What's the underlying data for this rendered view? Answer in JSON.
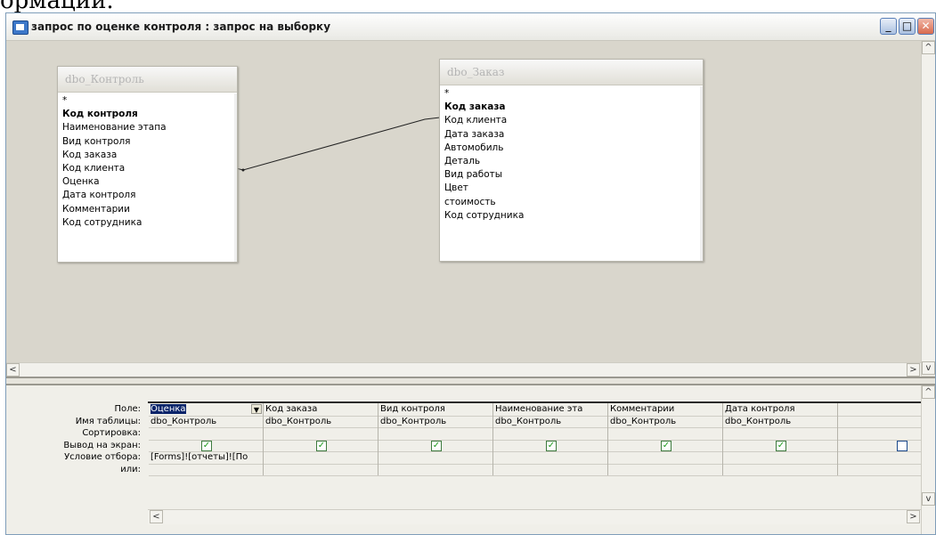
{
  "caption_above": "ормации.",
  "window": {
    "title": "запрос по оценке контроля : запрос на выборку",
    "minimize": "_",
    "maximize": "□",
    "close": "✕"
  },
  "tables": [
    {
      "name": "dbo_Контроль",
      "fields": [
        "*",
        "Код контроля",
        "Наименование этапа",
        "Вид контроля",
        "Код заказа",
        "Код клиента",
        "Оценка",
        "Дата контроля",
        "Комментарии",
        "Код сотрудника"
      ],
      "key_field": "Код контроля"
    },
    {
      "name": "dbo_Заказ",
      "fields": [
        "*",
        "Код заказа",
        "Код клиента",
        "Дата заказа",
        "Автомобиль",
        "Деталь",
        "Вид работы",
        "Цвет",
        "стоимость",
        "Код сотрудника"
      ],
      "key_field": "Код заказа"
    }
  ],
  "grid": {
    "row_labels": [
      "Поле:",
      "Имя таблицы:",
      "Сортировка:",
      "Вывод на экран:",
      "Условие отбора:",
      "или:"
    ],
    "columns": [
      {
        "field": "Оценка",
        "table": "dbo_Контроль",
        "sort": "",
        "show": true,
        "criteria": "[Forms]![отчеты]![По",
        "or": ""
      },
      {
        "field": "Код заказа",
        "table": "dbo_Контроль",
        "sort": "",
        "show": true,
        "criteria": "",
        "or": ""
      },
      {
        "field": "Вид контроля",
        "table": "dbo_Контроль",
        "sort": "",
        "show": true,
        "criteria": "",
        "or": ""
      },
      {
        "field": "Наименование эта",
        "table": "dbo_Контроль",
        "sort": "",
        "show": true,
        "criteria": "",
        "or": ""
      },
      {
        "field": "Комментарии",
        "table": "dbo_Контроль",
        "sort": "",
        "show": true,
        "criteria": "",
        "or": ""
      },
      {
        "field": "Дата контроля",
        "table": "dbo_Контроль",
        "sort": "",
        "show": true,
        "criteria": "",
        "or": ""
      },
      {
        "field": "",
        "table": "",
        "sort": "",
        "show": false,
        "criteria": "",
        "or": ""
      }
    ]
  },
  "scroll": {
    "left": "<",
    "right": ">",
    "up": "^",
    "down": "v"
  }
}
